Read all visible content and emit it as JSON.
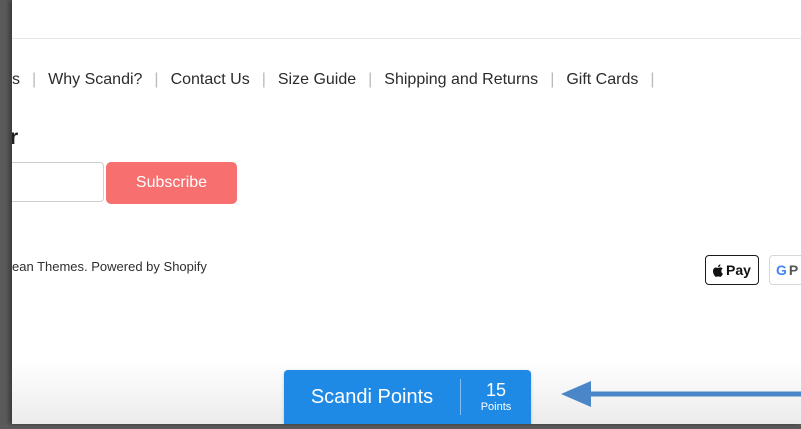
{
  "nav": {
    "items": [
      "s",
      "Why Scandi?",
      "Contact Us",
      "Size Guide",
      "Shipping and Returns",
      "Gift Cards"
    ],
    "separator": "|"
  },
  "newsletter": {
    "title": "r",
    "email_placeholder": "",
    "subscribe_label": "Subscribe"
  },
  "footer": {
    "credit_prefix": "ean Themes",
    "credit_sep": ". ",
    "credit_link": "Powered by Shopify"
  },
  "payments": {
    "apple_pay_label": "Pay",
    "google_pay_label": "P"
  },
  "points_widget": {
    "label": "Scandi Points",
    "count": "15",
    "unit": "Points",
    "color": "#1f8ae6"
  },
  "annotation": {
    "arrow_color": "#4a86c8"
  }
}
